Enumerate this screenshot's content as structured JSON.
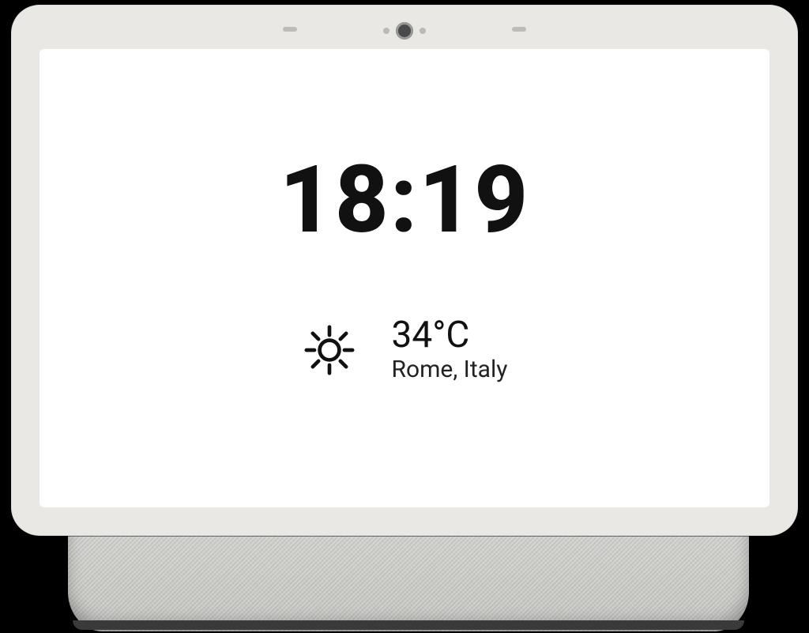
{
  "clock": {
    "time": "18:19"
  },
  "weather": {
    "icon": "sun-icon",
    "temperature": "34°C",
    "location": "Rome, Italy"
  }
}
